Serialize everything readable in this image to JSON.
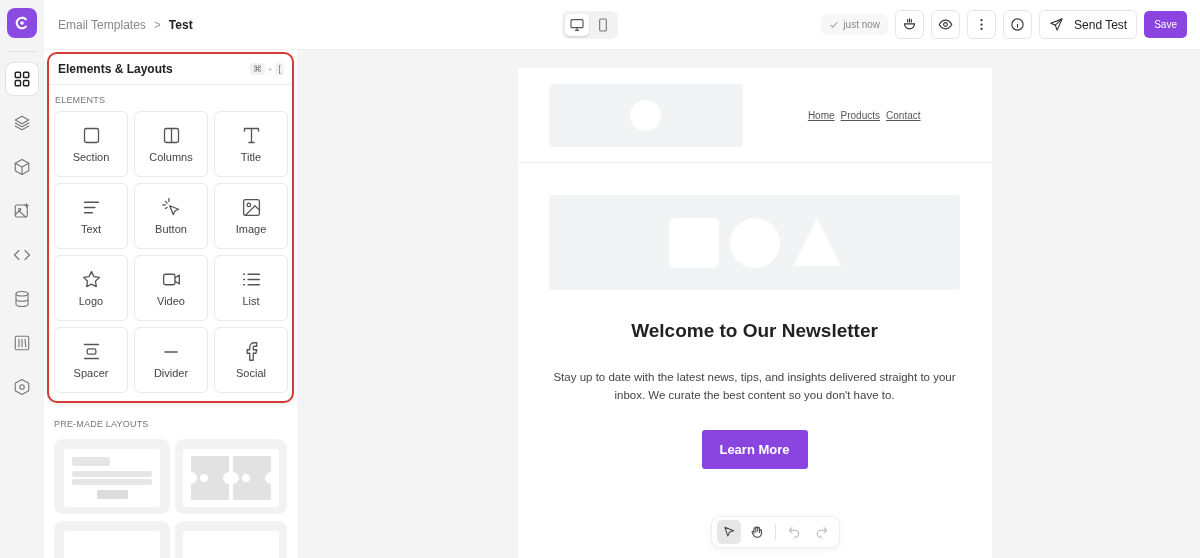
{
  "rail": [
    {
      "selected": true
    },
    {
      "selected": false
    },
    {
      "selected": false
    },
    {
      "selected": false
    },
    {
      "selected": false
    },
    {
      "selected": false
    },
    {
      "selected": false
    },
    {
      "selected": false
    }
  ],
  "breadcrumb": {
    "parent": "Email Templates",
    "separator": ">",
    "current": "Test"
  },
  "devices": [
    {
      "selected": true
    },
    {
      "selected": false
    }
  ],
  "topbar": {
    "status": "just now",
    "send_test": "Send Test",
    "save": "Save"
  },
  "panel": {
    "title": "Elements & Layouts",
    "shortcut": [
      "⌘",
      "+",
      "["
    ],
    "section": "ELEMENTS",
    "elements": [
      {
        "label": "Section"
      },
      {
        "label": "Columns"
      },
      {
        "label": "Title"
      },
      {
        "label": "Text"
      },
      {
        "label": "Button"
      },
      {
        "label": "Image"
      },
      {
        "label": "Logo"
      },
      {
        "label": "Video"
      },
      {
        "label": "List"
      },
      {
        "label": "Spacer"
      },
      {
        "label": "Divider"
      },
      {
        "label": "Social"
      }
    ],
    "layouts_title": "PRE-MADE LAYOUTS"
  },
  "email": {
    "nav": [
      "Home",
      "Products",
      "Contact"
    ],
    "heading": "Welcome to Our Newsletter",
    "body": "Stay up to date with the latest news, tips, and insights delivered straight to your inbox. We curate the best content so you don't have to.",
    "button": "Learn More"
  },
  "tools": [
    {
      "selected": true
    },
    {
      "selected": false
    }
  ]
}
